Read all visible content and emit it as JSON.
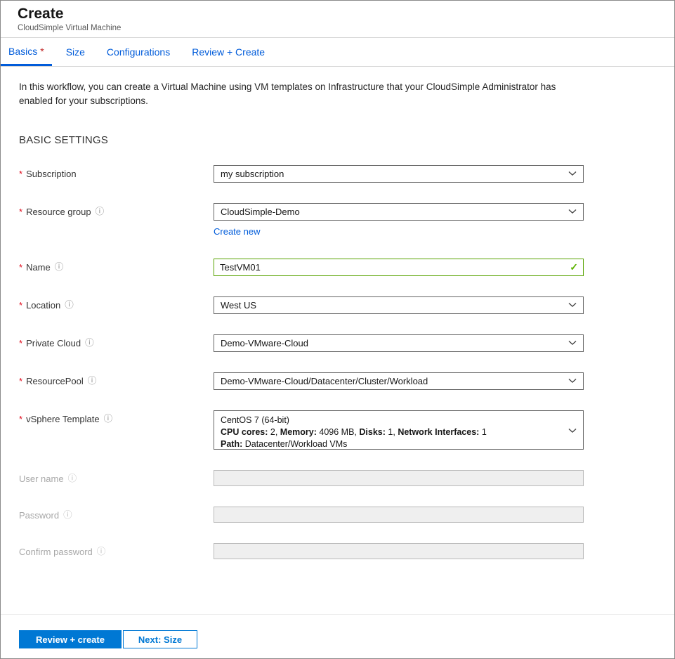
{
  "colors": {
    "tab_link_blue": "#015cda",
    "primary_button_blue": "#0078d4",
    "required_red": "#e00b1c",
    "valid_green": "#5db300"
  },
  "header": {
    "title": "Create",
    "subtitle": "CloudSimple Virtual Machine"
  },
  "tabs": [
    {
      "label": "Basics",
      "marker": "*"
    },
    {
      "label": "Size"
    },
    {
      "label": "Configurations"
    },
    {
      "label": "Review + Create"
    }
  ],
  "intro": "In this workflow, you can create a Virtual Machine using VM templates on Infrastructure that your CloudSimple Administrator has enabled for your subscriptions.",
  "section_title": "BASIC SETTINGS",
  "required_marker": "*",
  "info_icon": "ⓘ",
  "fields": {
    "subscription": {
      "label": "Subscription",
      "value": "my subscription"
    },
    "resource_group": {
      "label": "Resource group",
      "value": "CloudSimple-Demo",
      "create_new_link": "Create new"
    },
    "name": {
      "label": "Name",
      "value": "TestVM01",
      "valid_icon": "✓"
    },
    "location": {
      "label": "Location",
      "value": "West US"
    },
    "private_cloud": {
      "label": "Private Cloud",
      "value": "Demo-VMware-Cloud"
    },
    "resource_pool": {
      "label": "ResourcePool",
      "value": "Demo-VMware-Cloud/Datacenter/Cluster/Workload"
    },
    "vsphere_template": {
      "label": "vSphere Template",
      "template_name": "CentOS 7 (64-bit)",
      "cpu_label": "CPU cores:",
      "cpu_value": "2,",
      "memory_label": "Memory:",
      "memory_value": "4096 MB,",
      "disks_label": "Disks:",
      "disks_value": "1,",
      "nic_label": "Network Interfaces:",
      "nic_value": "1",
      "path_label": "Path:",
      "path_value": "Datacenter/Workload VMs"
    },
    "user_name": {
      "label": "User name",
      "value": ""
    },
    "password": {
      "label": "Password",
      "value": ""
    },
    "confirm_password": {
      "label": "Confirm password",
      "value": ""
    }
  },
  "footer": {
    "review_create_label": "Review + create",
    "next_label": "Next: Size"
  }
}
